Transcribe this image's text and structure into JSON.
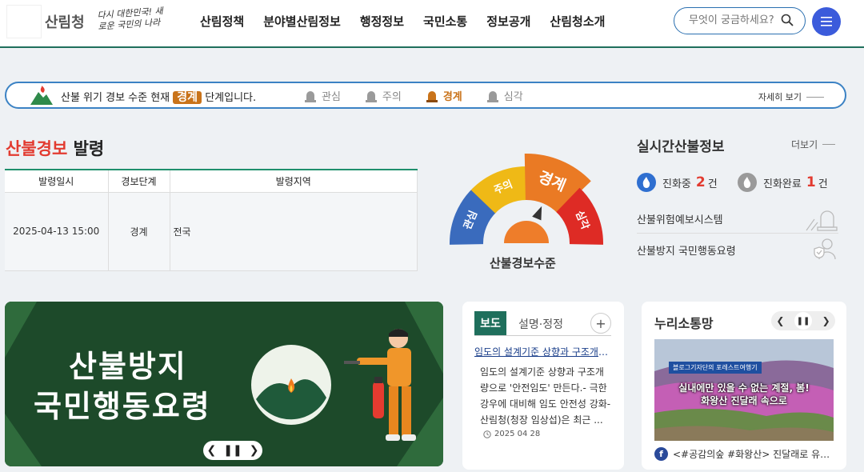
{
  "header": {
    "logo_text": "산림청",
    "slogan": "다시 대한민국! 새로운 국민의 나라",
    "nav": [
      "산림정책",
      "분야별산림정보",
      "행정정보",
      "국민소통",
      "정보공개",
      "산림청소개"
    ],
    "search_placeholder": "무엇이 궁금하세요?"
  },
  "alert_bar": {
    "prefix": "산불 위기 경보 수준 현재",
    "level": "경계",
    "suffix": "단계입니다.",
    "steps": [
      "관심",
      "주의",
      "경계",
      "심각"
    ],
    "active_step": "경계",
    "detail_link": "자세히 보기"
  },
  "warning": {
    "title_red": "산불경보",
    "title_rest": " 발령",
    "columns": [
      "발령일시",
      "경보단계",
      "발령지역"
    ],
    "rows": [
      [
        "2025-04-13 15:00",
        "경계",
        "전국"
      ]
    ]
  },
  "gauge": {
    "segments": [
      "관심",
      "주의",
      "경계",
      "심각"
    ],
    "colors": [
      "#3a6bbd",
      "#efb916",
      "#ea7a24",
      "#de2b25"
    ],
    "active": "경계",
    "label": "산불경보수준"
  },
  "realtime": {
    "title": "실시간산불정보",
    "more": "더보기",
    "in_progress_label": "진화중",
    "in_progress_count": "2",
    "completed_label": "진화완료",
    "completed_count": "1",
    "count_unit": "건",
    "links": [
      "산불위험예보시스템",
      "산불방지 국민행동요령"
    ]
  },
  "banner": {
    "line1": "산불방지",
    "line2": "국민행동요령"
  },
  "press": {
    "tab_active": "보도",
    "tab": "설명·정정",
    "headline": "임도의 설계기준 상향과 구조개량으로 안전임도",
    "body": "임도의 설계기준 상향과 구조개량으로 '안전임도' 만든다.- 극한 강우에 대비해 임도 안전성 강화- 산림청(청장 임상섭)은 최근 ...",
    "date": "2025 04 28"
  },
  "nuri": {
    "title": "누리소통망",
    "img_tag": "블로그기자단의 포레스트여행기",
    "img_line1": "실내에만 있을 수 없는 계절, 봄!",
    "img_line2": "화왕산 진달래 속으로",
    "caption": "<#공감의숲 #화왕산> 진달래로 유명한 화왕산"
  }
}
